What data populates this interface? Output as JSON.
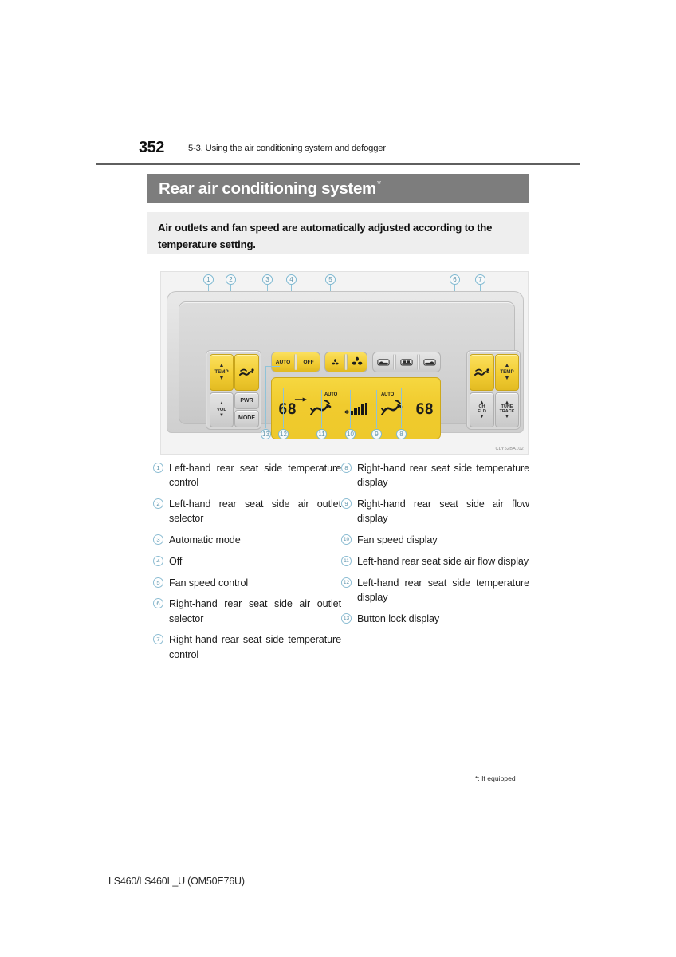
{
  "page": {
    "number": "352",
    "section": "5-3. Using the air conditioning system and defogger",
    "footer": "LS460/LS460L_U (OM50E76U)",
    "footnote": "*: If equipped"
  },
  "title": {
    "text": "Rear air conditioning system",
    "star": "*"
  },
  "intro": {
    "text": "Air outlets and fan speed are automatically adjusted according to the temperature setting."
  },
  "figure": {
    "code": "CLY52BA102",
    "callouts_top": [
      "1",
      "2",
      "3",
      "4",
      "5",
      "6",
      "7"
    ],
    "callouts_bottom": [
      "13",
      "12",
      "11",
      "10",
      "9",
      "8"
    ],
    "buttons": {
      "temp_left": "TEMP",
      "outlet_left": "outlet-icon",
      "vol": "VOL",
      "pwr": "PWR",
      "mode": "MODE",
      "auto": "AUTO",
      "off": "OFF",
      "fan_down": "fan-small-icon",
      "fan_up": "fan-large-icon",
      "seat_1": "seat-icon",
      "seat_2": "seat-icon",
      "seat_3": "seat-icon",
      "outlet_right": "outlet-icon",
      "temp_right": "TEMP",
      "ch_fld": "CH\nFLD",
      "ch_label_1": "CH",
      "ch_label_2": "FLD",
      "tune_label_1": "TUNE",
      "tune_label_2": "TRACK"
    },
    "lcd": {
      "temp_left": "68",
      "temp_right": "68",
      "auto_left": "AUTO",
      "auto_right": "AUTO",
      "lock_icon": "button-lock-icon",
      "airflow_left_icon": "airflow-icon",
      "airflow_right_icon": "airflow-icon",
      "fan_icon": "fan-speed-bargraph-icon",
      "fan_level": 5
    }
  },
  "legend": {
    "left": [
      {
        "num": "1",
        "label": "Left-hand rear seat side temperature control",
        "justify": true
      },
      {
        "num": "2",
        "label": "Left-hand rear seat side air outlet selector",
        "justify": true
      },
      {
        "num": "3",
        "label": "Automatic mode",
        "justify": false
      },
      {
        "num": "4",
        "label": "Off",
        "justify": false
      },
      {
        "num": "5",
        "label": "Fan speed control",
        "justify": false
      },
      {
        "num": "6",
        "label": "Right-hand rear seat side air outlet selector",
        "justify": true
      },
      {
        "num": "7",
        "label": "Right-hand rear seat side temperature control",
        "justify": true
      }
    ],
    "right": [
      {
        "num": "8",
        "label": "Right-hand rear seat side temperature display",
        "justify": true
      },
      {
        "num": "9",
        "label": "Right-hand rear seat side air flow display",
        "justify": true
      },
      {
        "num": "10",
        "label": "Fan speed display",
        "justify": false
      },
      {
        "num": "11",
        "label": "Left-hand rear seat side air flow display",
        "justify": true
      },
      {
        "num": "12",
        "label": "Left-hand rear seat side temperature display",
        "justify": true
      },
      {
        "num": "13",
        "label": "Button lock display",
        "justify": false
      }
    ]
  },
  "colors": {
    "title_bar": "#7d7d7d",
    "intro_bg": "#eeeeee",
    "button_yellow": "#f2cd34",
    "button_gray": "#d6d6d6",
    "callout_blue": "#7fb9d2",
    "lcd_amber": "#f0cb2e"
  }
}
